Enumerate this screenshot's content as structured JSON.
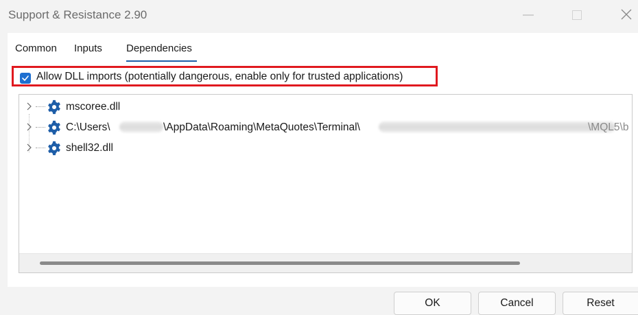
{
  "window": {
    "title": "Support & Resistance 2.90"
  },
  "tabs": [
    {
      "label": "Common"
    },
    {
      "label": "Inputs"
    },
    {
      "label": "Dependencies"
    }
  ],
  "active_tab": "Dependencies",
  "dll_option": {
    "checked": true,
    "label": "Allow DLL imports (potentially dangerous, enable only for trusted applications)"
  },
  "dependencies": [
    {
      "label": "mscoree.dll"
    },
    {
      "label_start": "C:\\Users\\",
      "label_mid": "\\AppData\\Roaming\\MetaQuotes\\Terminal\\",
      "label_end": "\\MQL5\\b"
    },
    {
      "label": "shell32.dll"
    }
  ],
  "buttons": {
    "ok": "OK",
    "cancel": "Cancel",
    "reset": "Reset"
  },
  "colors": {
    "accent": "#1e6fd0",
    "highlight_border": "#e0191f",
    "gear_icon": "#1e5ea8"
  }
}
